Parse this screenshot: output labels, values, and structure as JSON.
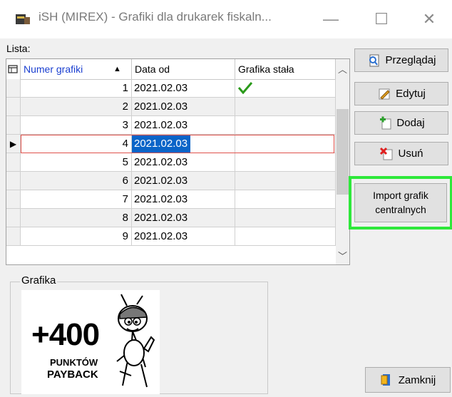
{
  "window": {
    "title": "iSH (MIREX) - Grafiki dla drukarek fiskaln...",
    "minimize": "—",
    "maximize": "☐",
    "close": "✕"
  },
  "list": {
    "label": "Lista:",
    "columns": {
      "number": "Numer grafiki",
      "date": "Data od",
      "fixed": "Grafika stała"
    },
    "rows": [
      {
        "number": "1",
        "date": "2021.02.03",
        "fixed": "✓"
      },
      {
        "number": "2",
        "date": "2021.02.03",
        "fixed": ""
      },
      {
        "number": "3",
        "date": "2021.02.03",
        "fixed": ""
      },
      {
        "number": "4",
        "date": "2021.02.03",
        "fixed": ""
      },
      {
        "number": "5",
        "date": "2021.02.03",
        "fixed": ""
      },
      {
        "number": "6",
        "date": "2021.02.03",
        "fixed": ""
      },
      {
        "number": "7",
        "date": "2021.02.03",
        "fixed": ""
      },
      {
        "number": "8",
        "date": "2021.02.03",
        "fixed": ""
      },
      {
        "number": "9",
        "date": "2021.02.03",
        "fixed": ""
      }
    ],
    "selected_row": 4
  },
  "buttons": {
    "przegladaj": "Przeglądaj",
    "edytuj": "Edytuj",
    "dodaj": "Dodaj",
    "usun": "Usuń",
    "import_line1": "Import grafik",
    "import_line2": "centralnych",
    "zamknij": "Zamknij"
  },
  "graphic": {
    "group_label": "Grafika",
    "big_text": "+400",
    "line1": "PUNKTÓW",
    "line2": "PAYBACK"
  },
  "colors": {
    "selection": "#0a64c8",
    "highlight": "#2ee83a",
    "check": "#2a9a1a"
  }
}
